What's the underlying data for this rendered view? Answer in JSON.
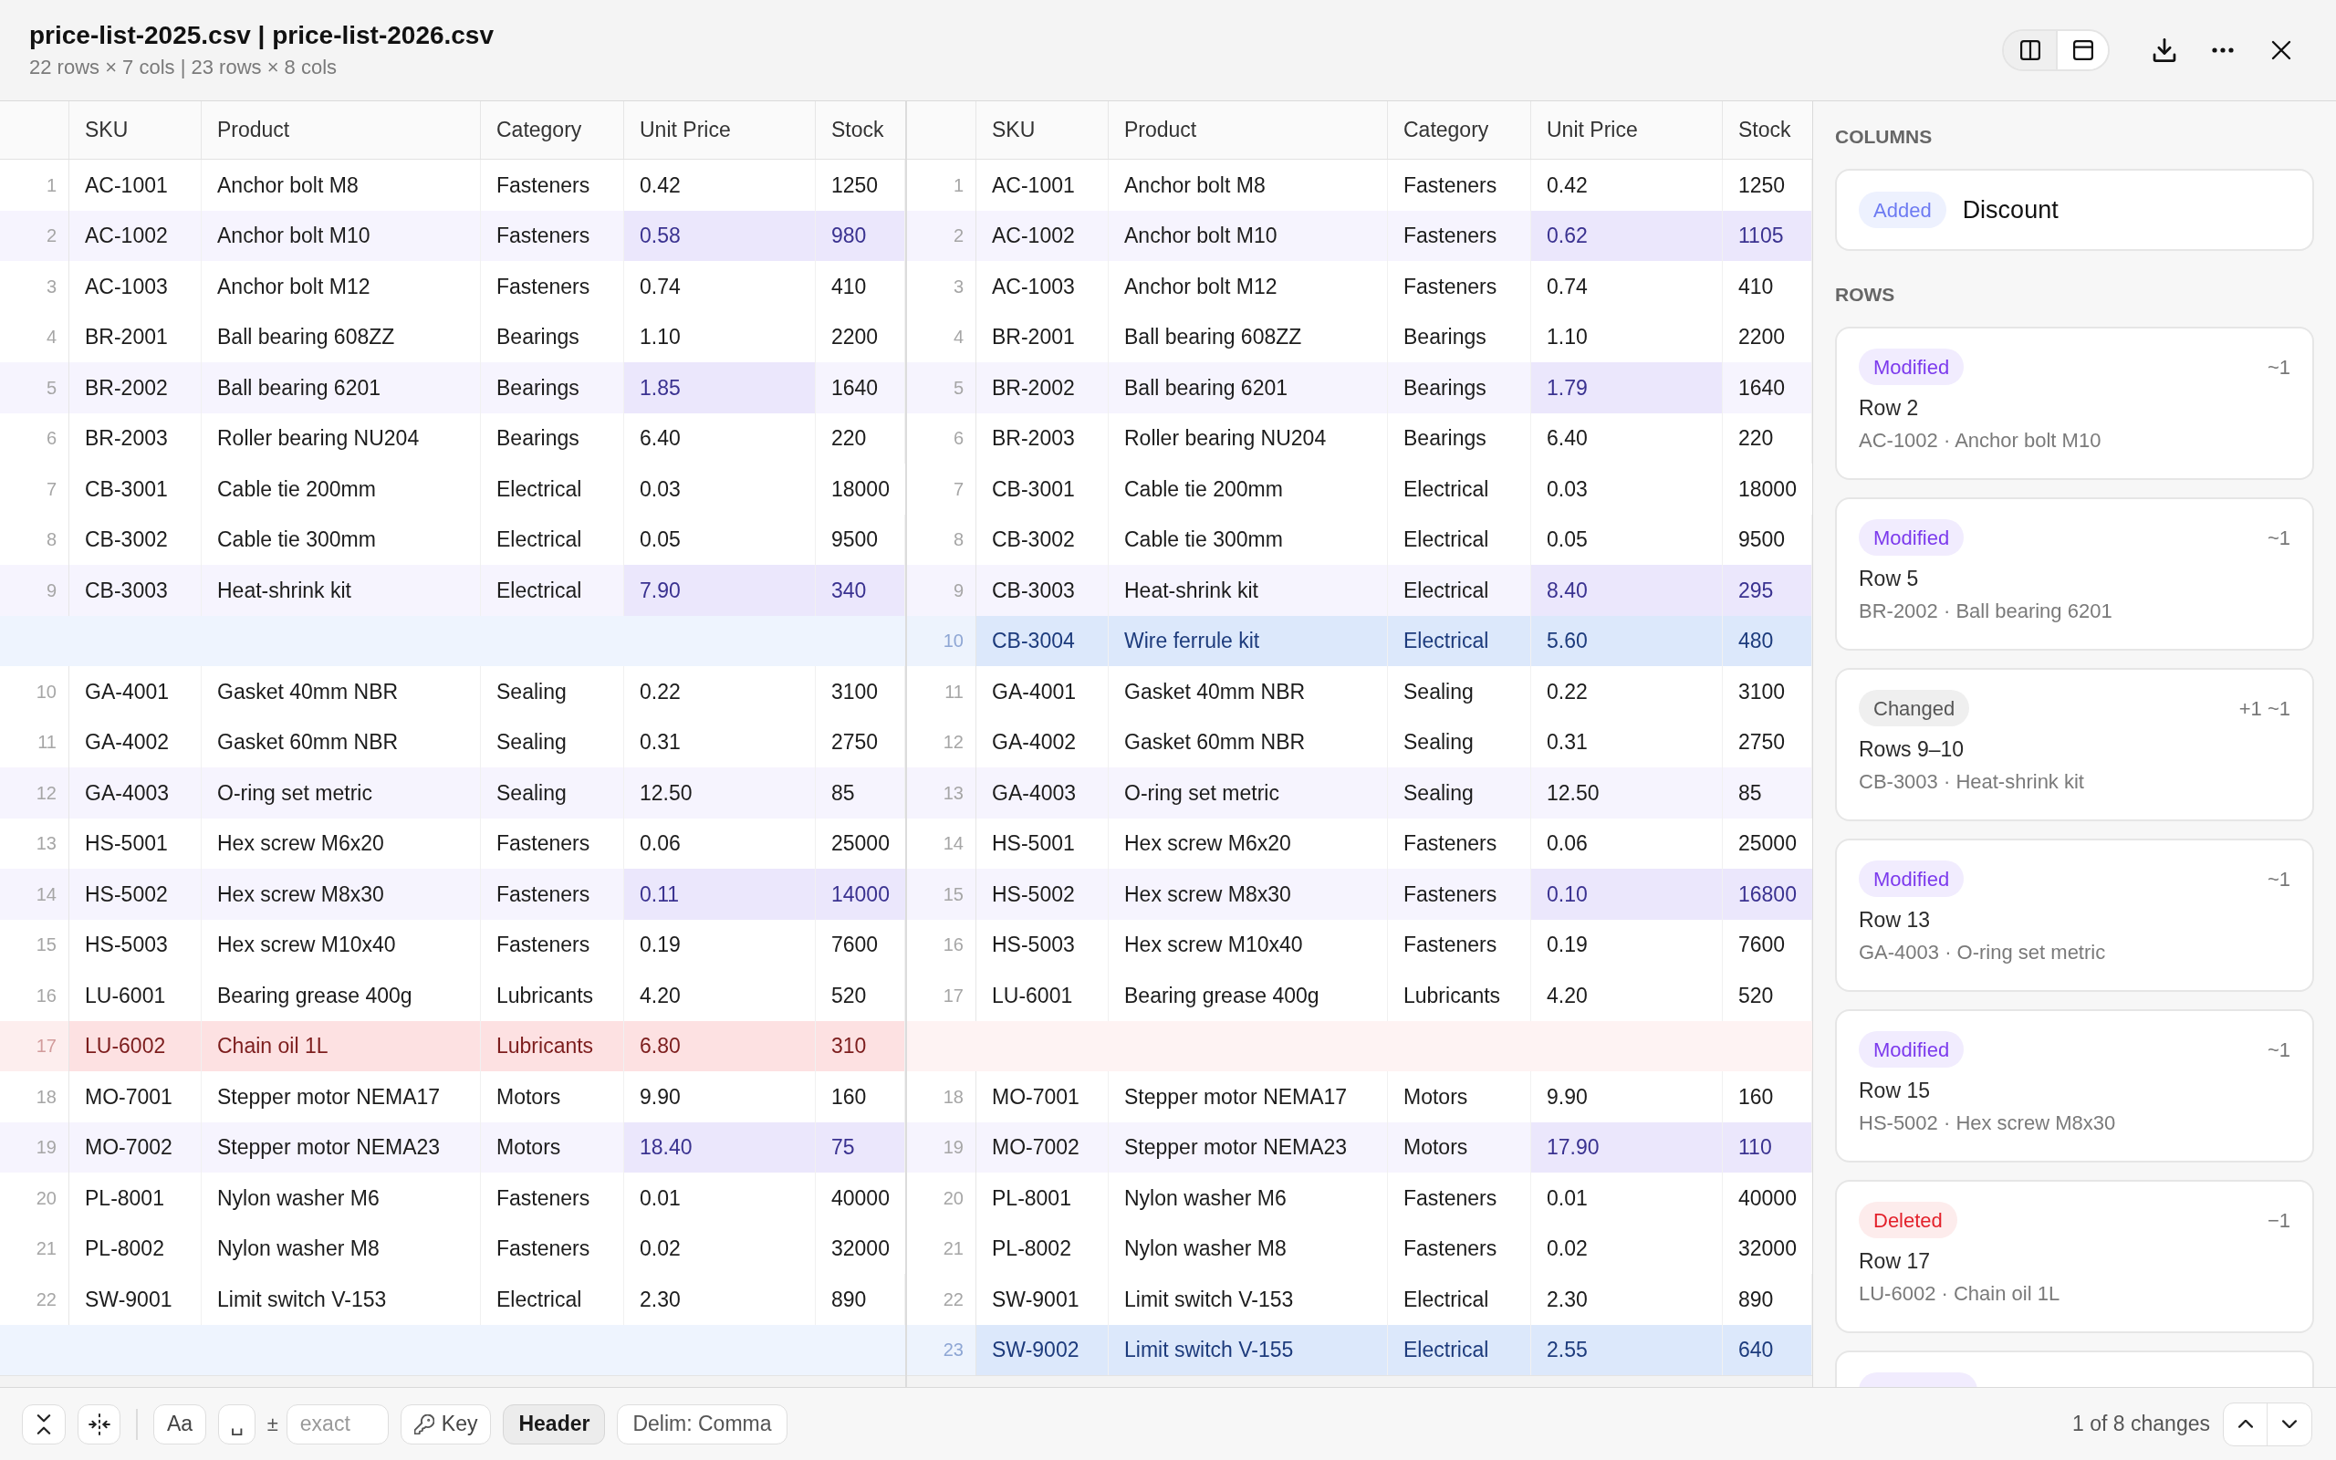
{
  "window": {
    "title": "price-list-2025.csv | price-list-2026.csv",
    "subtitle": "22 rows × 7 cols | 23 rows × 8 cols"
  },
  "view_modes": [
    {
      "kind": "side_by_side",
      "selected": false
    },
    {
      "kind": "stacked",
      "selected": true
    }
  ],
  "panes": [
    {
      "columns": [
        "SKU",
        "Product",
        "Category",
        "Unit Price",
        "Stock"
      ],
      "rows": [
        {
          "kind": "same",
          "number": "1",
          "cells": [
            "AC-1001",
            "Anchor bolt M8",
            "Fasteners",
            "0.42",
            "1250"
          ]
        },
        {
          "kind": "modified",
          "number": "2",
          "cells": [
            "AC-1002",
            "Anchor bolt M10",
            "Fasteners",
            "0.58",
            "980"
          ],
          "changed": [
            false,
            false,
            false,
            true,
            true
          ]
        },
        {
          "kind": "same",
          "number": "3",
          "cells": [
            "AC-1003",
            "Anchor bolt M12",
            "Fasteners",
            "0.74",
            "410"
          ]
        },
        {
          "kind": "same",
          "number": "4",
          "cells": [
            "BR-2001",
            "Ball bearing 608ZZ",
            "Bearings",
            "1.10",
            "2200"
          ]
        },
        {
          "kind": "modified",
          "number": "5",
          "cells": [
            "BR-2002",
            "Ball bearing 6201",
            "Bearings",
            "1.85",
            "1640"
          ],
          "changed": [
            false,
            false,
            false,
            true,
            false
          ]
        },
        {
          "kind": "same",
          "number": "6",
          "cells": [
            "BR-2003",
            "Roller bearing NU204",
            "Bearings",
            "6.40",
            "220"
          ]
        },
        {
          "kind": "same",
          "number": "7",
          "cells": [
            "CB-3001",
            "Cable tie 200mm",
            "Electrical",
            "0.03",
            "18000"
          ]
        },
        {
          "kind": "same",
          "number": "8",
          "cells": [
            "CB-3002",
            "Cable tie 300mm",
            "Electrical",
            "0.05",
            "9500"
          ]
        },
        {
          "kind": "modified",
          "number": "9",
          "cells": [
            "CB-3003",
            "Heat-shrink kit",
            "Electrical",
            "7.90",
            "340"
          ],
          "changed": [
            false,
            false,
            false,
            true,
            true
          ]
        },
        {
          "kind": "gap_added"
        },
        {
          "kind": "same",
          "number": "10",
          "cells": [
            "GA-4001",
            "Gasket 40mm NBR",
            "Sealing",
            "0.22",
            "3100"
          ]
        },
        {
          "kind": "same",
          "number": "11",
          "cells": [
            "GA-4002",
            "Gasket 60mm NBR",
            "Sealing",
            "0.31",
            "2750"
          ]
        },
        {
          "kind": "modified",
          "number": "12",
          "cells": [
            "GA-4003",
            "O-ring set metric",
            "Sealing",
            "12.50",
            "85"
          ],
          "changed": [
            false,
            false,
            false,
            false,
            false
          ]
        },
        {
          "kind": "same",
          "number": "13",
          "cells": [
            "HS-5001",
            "Hex screw M6x20",
            "Fasteners",
            "0.06",
            "25000"
          ]
        },
        {
          "kind": "modified",
          "number": "14",
          "cells": [
            "HS-5002",
            "Hex screw M8x30",
            "Fasteners",
            "0.11",
            "14000"
          ],
          "changed": [
            false,
            false,
            false,
            true,
            true
          ]
        },
        {
          "kind": "same",
          "number": "15",
          "cells": [
            "HS-5003",
            "Hex screw M10x40",
            "Fasteners",
            "0.19",
            "7600"
          ]
        },
        {
          "kind": "same",
          "number": "16",
          "cells": [
            "LU-6001",
            "Bearing grease 400g",
            "Lubricants",
            "4.20",
            "520"
          ]
        },
        {
          "kind": "deleted",
          "number": "17",
          "cells": [
            "LU-6002",
            "Chain oil 1L",
            "Lubricants",
            "6.80",
            "310"
          ]
        },
        {
          "kind": "same",
          "number": "18",
          "cells": [
            "MO-7001",
            "Stepper motor NEMA17",
            "Motors",
            "9.90",
            "160"
          ]
        },
        {
          "kind": "modified",
          "number": "19",
          "cells": [
            "MO-7002",
            "Stepper motor NEMA23",
            "Motors",
            "18.40",
            "75"
          ],
          "changed": [
            false,
            false,
            false,
            true,
            true
          ]
        },
        {
          "kind": "same",
          "number": "20",
          "cells": [
            "PL-8001",
            "Nylon washer M6",
            "Fasteners",
            "0.01",
            "40000"
          ]
        },
        {
          "kind": "same",
          "number": "21",
          "cells": [
            "PL-8002",
            "Nylon washer M8",
            "Fasteners",
            "0.02",
            "32000"
          ]
        },
        {
          "kind": "same",
          "number": "22",
          "cells": [
            "SW-9001",
            "Limit switch V-153",
            "Electrical",
            "2.30",
            "890"
          ]
        },
        {
          "kind": "gap_added"
        }
      ]
    },
    {
      "columns": [
        "SKU",
        "Product",
        "Category",
        "Unit Price",
        "Stock"
      ],
      "rows": [
        {
          "kind": "same",
          "number": "1",
          "cells": [
            "AC-1001",
            "Anchor bolt M8",
            "Fasteners",
            "0.42",
            "1250"
          ]
        },
        {
          "kind": "modified",
          "number": "2",
          "cells": [
            "AC-1002",
            "Anchor bolt M10",
            "Fasteners",
            "0.62",
            "1105"
          ],
          "changed": [
            false,
            false,
            false,
            true,
            true
          ]
        },
        {
          "kind": "same",
          "number": "3",
          "cells": [
            "AC-1003",
            "Anchor bolt M12",
            "Fasteners",
            "0.74",
            "410"
          ]
        },
        {
          "kind": "same",
          "number": "4",
          "cells": [
            "BR-2001",
            "Ball bearing 608ZZ",
            "Bearings",
            "1.10",
            "2200"
          ]
        },
        {
          "kind": "modified",
          "number": "5",
          "cells": [
            "BR-2002",
            "Ball bearing 6201",
            "Bearings",
            "1.79",
            "1640"
          ],
          "changed": [
            false,
            false,
            false,
            true,
            false
          ]
        },
        {
          "kind": "same",
          "number": "6",
          "cells": [
            "BR-2003",
            "Roller bearing NU204",
            "Bearings",
            "6.40",
            "220"
          ]
        },
        {
          "kind": "same",
          "number": "7",
          "cells": [
            "CB-3001",
            "Cable tie 200mm",
            "Electrical",
            "0.03",
            "18000"
          ]
        },
        {
          "kind": "same",
          "number": "8",
          "cells": [
            "CB-3002",
            "Cable tie 300mm",
            "Electrical",
            "0.05",
            "9500"
          ]
        },
        {
          "kind": "modified",
          "number": "9",
          "cells": [
            "CB-3003",
            "Heat-shrink kit",
            "Electrical",
            "8.40",
            "295"
          ],
          "changed": [
            false,
            false,
            false,
            true,
            true
          ]
        },
        {
          "kind": "added",
          "number": "10",
          "cells": [
            "CB-3004",
            "Wire ferrule kit",
            "Electrical",
            "5.60",
            "480"
          ]
        },
        {
          "kind": "same",
          "number": "11",
          "cells": [
            "GA-4001",
            "Gasket 40mm NBR",
            "Sealing",
            "0.22",
            "3100"
          ]
        },
        {
          "kind": "same",
          "number": "12",
          "cells": [
            "GA-4002",
            "Gasket 60mm NBR",
            "Sealing",
            "0.31",
            "2750"
          ]
        },
        {
          "kind": "modified",
          "number": "13",
          "cells": [
            "GA-4003",
            "O-ring set metric",
            "Sealing",
            "12.50",
            "85"
          ],
          "changed": [
            false,
            false,
            false,
            false,
            false
          ]
        },
        {
          "kind": "same",
          "number": "14",
          "cells": [
            "HS-5001",
            "Hex screw M6x20",
            "Fasteners",
            "0.06",
            "25000"
          ]
        },
        {
          "kind": "modified",
          "number": "15",
          "cells": [
            "HS-5002",
            "Hex screw M8x30",
            "Fasteners",
            "0.10",
            "16800"
          ],
          "changed": [
            false,
            false,
            false,
            true,
            true
          ]
        },
        {
          "kind": "same",
          "number": "16",
          "cells": [
            "HS-5003",
            "Hex screw M10x40",
            "Fasteners",
            "0.19",
            "7600"
          ]
        },
        {
          "kind": "same",
          "number": "17",
          "cells": [
            "LU-6001",
            "Bearing grease 400g",
            "Lubricants",
            "4.20",
            "520"
          ]
        },
        {
          "kind": "gap_deleted"
        },
        {
          "kind": "same",
          "number": "18",
          "cells": [
            "MO-7001",
            "Stepper motor NEMA17",
            "Motors",
            "9.90",
            "160"
          ]
        },
        {
          "kind": "modified",
          "number": "19",
          "cells": [
            "MO-7002",
            "Stepper motor NEMA23",
            "Motors",
            "17.90",
            "110"
          ],
          "changed": [
            false,
            false,
            false,
            true,
            true
          ]
        },
        {
          "kind": "same",
          "number": "20",
          "cells": [
            "PL-8001",
            "Nylon washer M6",
            "Fasteners",
            "0.01",
            "40000"
          ]
        },
        {
          "kind": "same",
          "number": "21",
          "cells": [
            "PL-8002",
            "Nylon washer M8",
            "Fasteners",
            "0.02",
            "32000"
          ]
        },
        {
          "kind": "same",
          "number": "22",
          "cells": [
            "SW-9001",
            "Limit switch V-153",
            "Electrical",
            "2.30",
            "890"
          ]
        },
        {
          "kind": "added",
          "number": "23",
          "cells": [
            "SW-9002",
            "Limit switch V-155",
            "Electrical",
            "2.55",
            "640"
          ]
        }
      ]
    }
  ],
  "changes_panel": {
    "columns_heading": "COLUMNS",
    "column_changes": [
      {
        "kind": "added",
        "badge": "Added",
        "name": "Discount"
      }
    ],
    "rows_heading": "ROWS",
    "row_changes": [
      {
        "kind": "modified",
        "badge": "Modified",
        "count": "~1",
        "title": "Row 2",
        "detail": "AC-1002 · Anchor bolt M10"
      },
      {
        "kind": "modified",
        "badge": "Modified",
        "count": "~1",
        "title": "Row 5",
        "detail": "BR-2002 · Ball bearing 6201"
      },
      {
        "kind": "changed",
        "badge": "Changed",
        "count": "+1 ~1",
        "title": "Rows 9–10",
        "detail": "CB-3003 · Heat-shrink kit"
      },
      {
        "kind": "modified",
        "badge": "Modified",
        "count": "~1",
        "title": "Row 13",
        "detail": "GA-4003 · O-ring set metric"
      },
      {
        "kind": "modified",
        "badge": "Modified",
        "count": "~1",
        "title": "Row 15",
        "detail": "HS-5002 · Hex screw M8x30"
      },
      {
        "kind": "deleted",
        "badge": "Deleted",
        "count": "−1",
        "title": "Row 17",
        "detail": "LU-6002 · Chain oil 1L"
      },
      {
        "kind": "modified"
      }
    ]
  },
  "toolbar": {
    "case_toggle": {
      "label": "Aa",
      "on": false
    },
    "whitespace_toggle": {
      "label": "␣",
      "on": false
    },
    "tolerance": {
      "symbol": "±",
      "placeholder": "exact"
    },
    "key_button": {
      "label": "Key",
      "on": false
    },
    "header_toggle": {
      "label": "Header",
      "on": true
    },
    "delimiter_button": {
      "label": "Delim: Comma"
    },
    "change_counter": "1 of 8 changes"
  }
}
